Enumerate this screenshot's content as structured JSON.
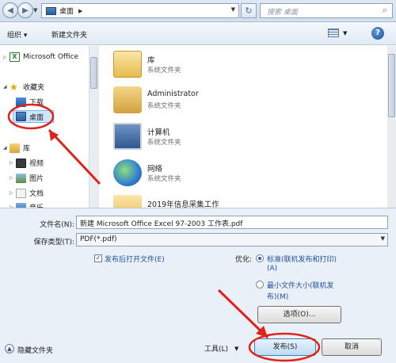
{
  "address_bar": {
    "location": "桌面",
    "search_placeholder": "搜索 桌面"
  },
  "toolbar": {
    "organize_label": "组织 ▾",
    "new_folder_label": "新建文件夹"
  },
  "nav_pane": {
    "items": [
      {
        "label": "Microsoft Office"
      },
      {
        "label": "收藏夹"
      },
      {
        "label": "下载"
      },
      {
        "label": "桌面"
      },
      {
        "label": "库"
      },
      {
        "label": "视频"
      },
      {
        "label": "图片"
      },
      {
        "label": "文档"
      },
      {
        "label": "音乐"
      }
    ]
  },
  "content": {
    "items": [
      {
        "name": "库",
        "type": "系统文件夹"
      },
      {
        "name": "Administrator",
        "type": "系统文件夹"
      },
      {
        "name": "计算机",
        "type": "系统文件夹"
      },
      {
        "name": "网络",
        "type": "系统文件夹"
      },
      {
        "name": "2019年信息采集工作",
        "type": ""
      }
    ]
  },
  "form": {
    "filename_label": "文件名(N):",
    "filename_value": "新建 Microsoft Office Excel 97-2003 工作表.pdf",
    "filetype_label": "保存类型(T):",
    "filetype_value": "PDF(*.pdf)",
    "open_after_publish_label": "发布后打开文件(E)",
    "optimize_label": "优化:",
    "option_standard_line1": "标准(联机发布和打印)",
    "option_standard_line2": "(A)",
    "option_minimum_line1": "最小文件大小(联机发",
    "option_minimum_line2": "布)(M)",
    "options_button_label": "选项(O)...",
    "hide_folders_label": "隐藏文件夹",
    "tools_label": "工具(L)",
    "publish_button_label": "发布(S)",
    "cancel_button_label": "取消"
  },
  "colors": {
    "annotation_red": "#e0221a",
    "selection_blue": "#cde6fb"
  }
}
